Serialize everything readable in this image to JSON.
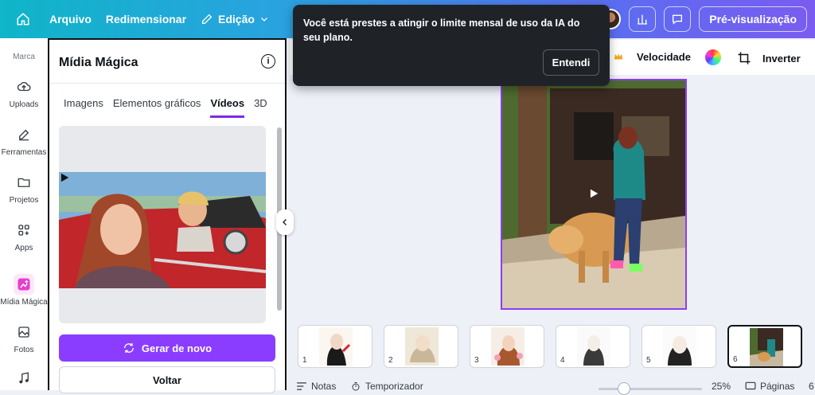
{
  "topbar": {
    "menu_file": "Arquivo",
    "menu_resize": "Redimensionar",
    "menu_edit": "Edição",
    "preview_label": "Pré-visualização"
  },
  "rail": {
    "brand": "Marca",
    "items": [
      {
        "label": "Uploads",
        "icon": "cloud-upload-icon"
      },
      {
        "label": "Ferramentas",
        "icon": "pen-tool-icon"
      },
      {
        "label": "Projetos",
        "icon": "folder-icon"
      },
      {
        "label": "Apps",
        "icon": "apps-grid-icon"
      },
      {
        "label": "Mídia Mágica",
        "icon": "magic-media-icon"
      },
      {
        "label": "Fotos",
        "icon": "image-icon"
      },
      {
        "label": "",
        "icon": "music-note-icon"
      }
    ]
  },
  "panel": {
    "title": "Mídia Mágica",
    "tabs": [
      "Imagens",
      "Elementos gráficos",
      "Vídeos",
      "3D"
    ],
    "active_tab": "Vídeos",
    "regenerate_label": "Gerar de novo",
    "back_label": "Voltar"
  },
  "toolbar2": {
    "speed_label": "Velocidade",
    "flip_label": "Inverter"
  },
  "thumbnails": [
    "1",
    "2",
    "3",
    "4",
    "5",
    "6"
  ],
  "bottombar": {
    "notes_label": "Notas",
    "timer_label": "Temporizador",
    "zoom_value": "25%",
    "pages_label": "Páginas",
    "pages_count": "6"
  },
  "toast": {
    "message": "Você está prestes a atingir o limite mensal de uso da IA do seu plano.",
    "button_label": "Entendi"
  },
  "colors": {
    "accent": "#8b3dff",
    "topbar_start": "#0fb5c8",
    "topbar_end": "#7a5cf0",
    "toast_bg": "#1f2328"
  }
}
